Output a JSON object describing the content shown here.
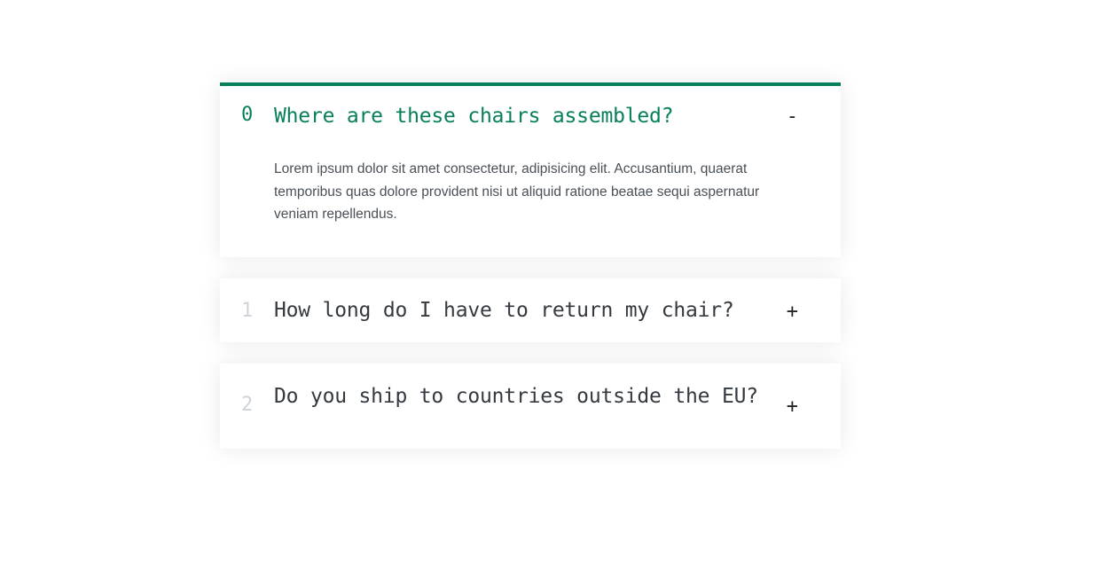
{
  "accent_color": "#087f5b",
  "faq": {
    "items": [
      {
        "number": "0",
        "question": "Where are these chairs assembled?",
        "toggle": "-",
        "answer": "Lorem ipsum dolor sit amet consectetur, adipisicing elit. Accusantium, quaerat temporibus quas dolore provident nisi ut aliquid ratione beatae sequi aspernatur veniam repellendus.",
        "expanded": true
      },
      {
        "number": "1",
        "question": "How long do I have to return my chair?",
        "toggle": "+",
        "expanded": false
      },
      {
        "number": "2",
        "question": "Do you ship to countries outside the EU?",
        "toggle": "+",
        "expanded": false
      }
    ]
  }
}
